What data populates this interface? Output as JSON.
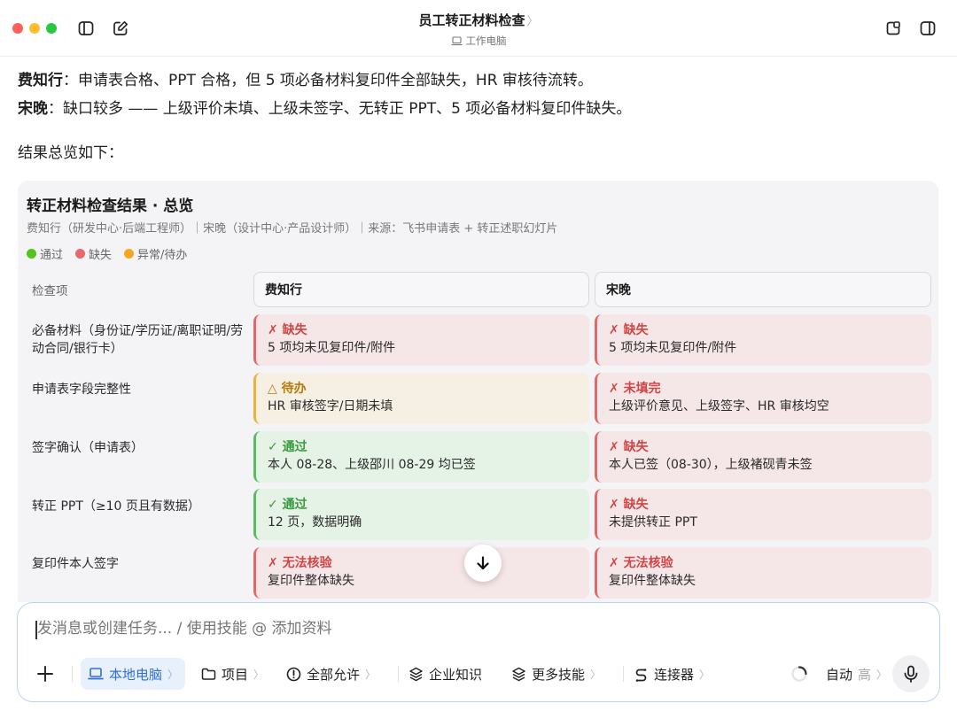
{
  "window": {
    "title": "员工转正材料检查",
    "title_chevron": "〉",
    "subtitle": "工作电脑"
  },
  "message": {
    "lines": [
      {
        "name": "费知行",
        "sep": "：",
        "text": "申请表合格、PPT 合格，但 5 项必备材料复印件全部缺失，HR 审核待流转。"
      },
      {
        "name": "宋晚",
        "sep": "：",
        "text": "缺口较多 —— 上级评价未填、上级未签字、无转正 PPT、5 项必备材料复印件缺失。"
      }
    ],
    "summary_intro": "结果总览如下："
  },
  "card": {
    "title": "转正材料检查结果 · 总览",
    "subtitle": "费知行（研发中心·后端工程师）｜宋晚（设计中心·产品设计师）｜来源：飞书申请表 + 转正述职幻灯片",
    "legend": [
      {
        "label": "通过",
        "color": "#52c41a"
      },
      {
        "label": "缺失",
        "color": "#e8696b"
      },
      {
        "label": "异常/待办",
        "color": "#f5a623"
      }
    ],
    "column_label": "检查项",
    "columns": [
      "费知行",
      "宋晚"
    ],
    "rows": [
      {
        "label": "必备材料（身份证/学历证/离职证明/劳动合同/银行卡）",
        "cells": [
          {
            "kind": "bad",
            "status": "✗ 缺失",
            "detail": "5 项均未见复印件/附件"
          },
          {
            "kind": "bad",
            "status": "✗ 缺失",
            "detail": "5 项均未见复印件/附件"
          }
        ]
      },
      {
        "label": "申请表字段完整性",
        "cells": [
          {
            "kind": "pend",
            "status": "△ 待办",
            "detail": "HR 审核签字/日期未填"
          },
          {
            "kind": "bad",
            "status": "✗ 未填完",
            "detail": "上级评价意见、上级签字、HR 审核均空"
          }
        ]
      },
      {
        "label": "签字确认（申请表）",
        "cells": [
          {
            "kind": "ok",
            "status": "✓ 通过",
            "detail": "本人 08-28、上级邵川 08-29 均已签"
          },
          {
            "kind": "bad",
            "status": "✗ 缺失",
            "detail": "本人已签（08-30），上级褚砚青未签"
          }
        ]
      },
      {
        "label": "转正 PPT（≥10 页且有数据）",
        "cells": [
          {
            "kind": "ok",
            "status": "✓ 通过",
            "detail": "12 页，数据明确"
          },
          {
            "kind": "bad",
            "status": "✗ 缺失",
            "detail": "未提供转正 PPT"
          }
        ]
      },
      {
        "label": "复印件本人签字",
        "cells": [
          {
            "kind": "bad",
            "status": "✗ 无法核验",
            "detail": "复印件整体缺失"
          },
          {
            "kind": "bad",
            "status": "✗ 无法核验",
            "detail": "复印件整体缺失"
          }
        ]
      }
    ]
  },
  "composer": {
    "placeholder": "发消息或创建任务... / 使用技能 @ 添加资料",
    "tools": {
      "local": "本地电脑",
      "project": "项目",
      "allow_all": "全部允许",
      "enterprise": "企业知识",
      "more_skills": "更多技能",
      "connectors": "连接器",
      "mode": "自动",
      "level": "高"
    },
    "chevron": "〉"
  }
}
